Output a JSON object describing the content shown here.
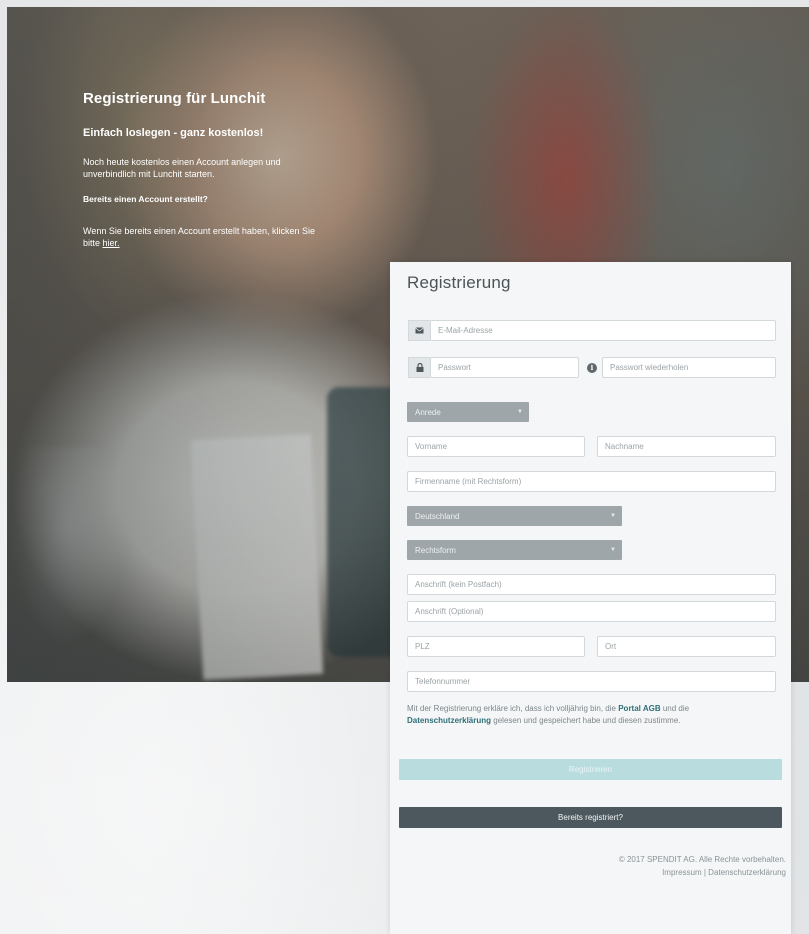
{
  "hero": {
    "title": "Registrierung für Lunchit",
    "subtitle": "Einfach loslegen - ganz kostenlos!",
    "intro": "Noch heute kostenlos einen Account anlegen und unverbindlich mit Lunchit starten.",
    "account_heading": "Bereits einen Account erstellt?",
    "account_text": "Wenn Sie bereits einen Account erstellt haben, klicken Sie bitte",
    "account_link": "hier."
  },
  "form": {
    "title": "Registrierung",
    "email_placeholder": "E-Mail-Adresse",
    "password_placeholder": "Passwort",
    "password_repeat_placeholder": "Passwort wiederholen",
    "salutation": "Anrede",
    "firstname_placeholder": "Vorname",
    "lastname_placeholder": "Nachname",
    "company_placeholder": "Firmenname (mit Rechtsform)",
    "country": "Deutschland",
    "legal_form": "Rechtsform",
    "address1_placeholder": "Anschrift (kein Postfach)",
    "address2_placeholder": "Anschrift (Optional)",
    "zip_placeholder": "PLZ",
    "city_placeholder": "Ort",
    "phone_placeholder": "Telefonnummer",
    "legal_text_1": "Mit der Registrierung erkläre ich, dass ich volljährig bin, die",
    "legal_link_agb": "Portal AGB",
    "legal_text_2": "und die",
    "legal_link_privacy": "Datenschutzerklärung",
    "legal_text_3": "gelesen und gespeichert habe und diesen zustimme.",
    "register_button": "Registrieren",
    "login_button": "Bereits registriert?"
  },
  "footer": {
    "copyright": "© 2017 SPENDIT AG. Alle Rechte vorbehalten.",
    "imprint": "Impressum",
    "separator": "|",
    "privacy": "Datenschutzerklärung"
  },
  "colors": {
    "register_button": "#b9dcdf",
    "login_button": "#4c585e",
    "select_bg": "#9ea6aa",
    "link": "#2f6f78"
  },
  "icons": {
    "email": "envelope-icon",
    "password": "lock-icon",
    "info": "info-icon",
    "dropdown": "chevron-down-icon"
  }
}
